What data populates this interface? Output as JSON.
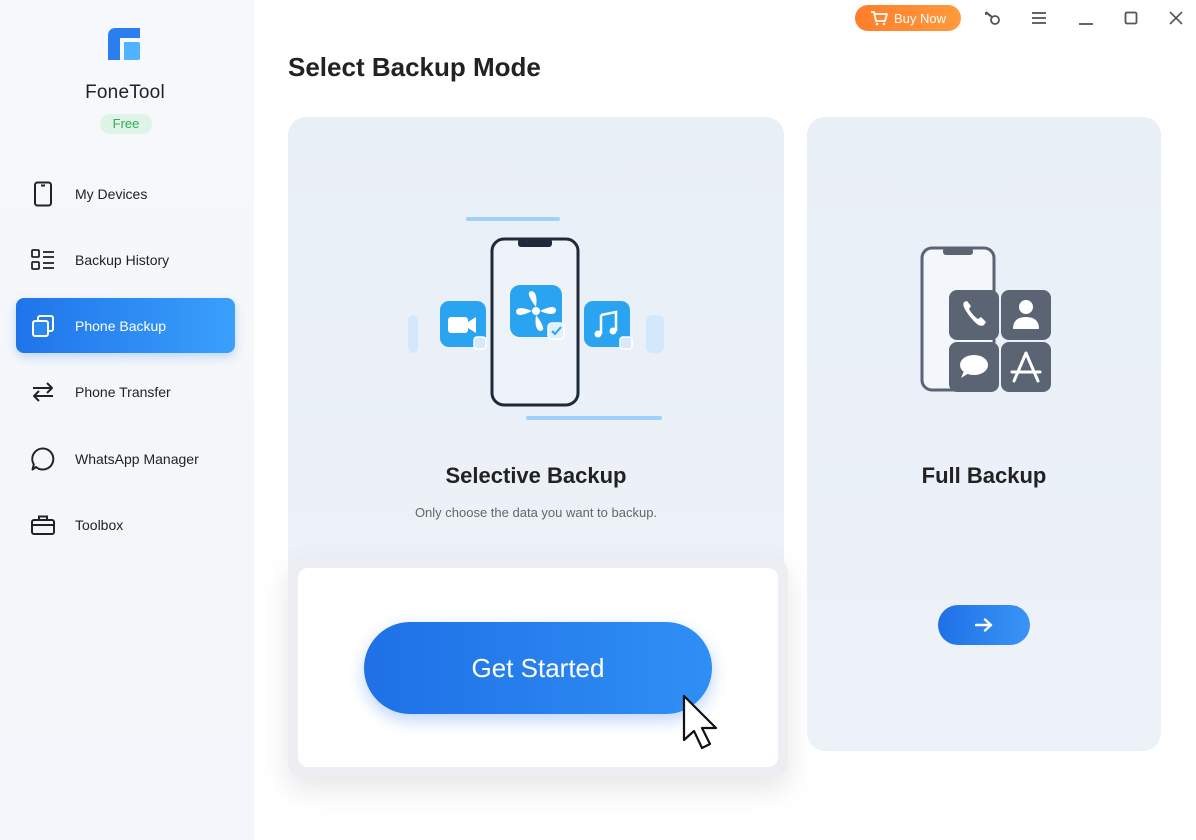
{
  "app": {
    "name": "FoneTool",
    "edition": "Free",
    "brand_color": "#1f74ea",
    "logo_icon": "fonetool-logo"
  },
  "titlebar": {
    "buy_now_label": "Buy Now",
    "buy_now_color": "#ff8a33",
    "buttons": [
      "key-icon",
      "menu-icon",
      "minimize-icon",
      "maximize-icon",
      "close-icon"
    ]
  },
  "sidebar": {
    "items": [
      {
        "label": "My Devices",
        "icon": "phone-icon",
        "active": false
      },
      {
        "label": "Backup History",
        "icon": "list-icon",
        "active": false
      },
      {
        "label": "Phone Backup",
        "icon": "copy-icon",
        "active": true
      },
      {
        "label": "Phone Transfer",
        "icon": "transfer-icon",
        "active": false
      },
      {
        "label": "WhatsApp Manager",
        "icon": "chat-bubble-icon",
        "active": false
      },
      {
        "label": "Toolbox",
        "icon": "toolbox-icon",
        "active": false
      }
    ]
  },
  "main": {
    "title": "Select Backup Mode",
    "selective": {
      "title": "Selective Backup",
      "description": "Only choose the data you want to backup.",
      "button_label": "Get Started"
    },
    "full": {
      "title": "Full Backup",
      "button_icon": "arrow-right-icon"
    }
  }
}
